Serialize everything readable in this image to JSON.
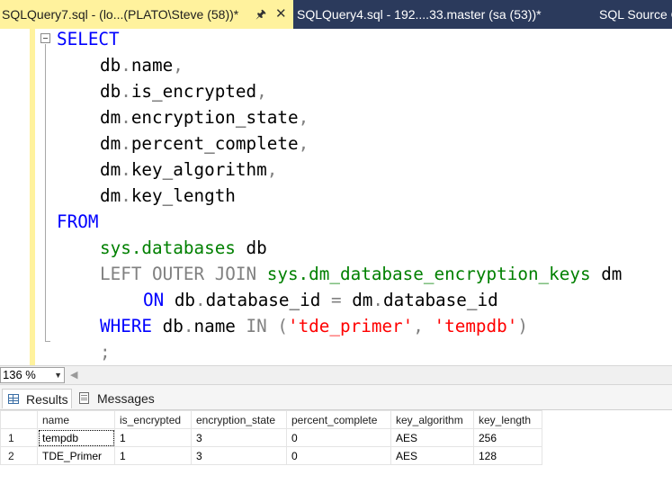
{
  "tabs": [
    {
      "title": "SQLQuery7.sql - (lo...(PLATO\\Steve (58))*",
      "pin_icon": "pin-icon",
      "close_icon": "close-icon"
    },
    {
      "title": "SQLQuery4.sql - 192....33.master (sa (53))*"
    },
    {
      "title": "SQL Source C"
    }
  ],
  "editor": {
    "l1": {
      "kw": "SELECT"
    },
    "l2": {
      "a": "db",
      "dot": ".",
      "b": "name",
      "c": ","
    },
    "l3": {
      "a": "db",
      "dot": ".",
      "b": "is_encrypted",
      "c": ","
    },
    "l4": {
      "a": "dm",
      "dot": ".",
      "b": "encryption_state",
      "c": ","
    },
    "l5": {
      "a": "dm",
      "dot": ".",
      "b": "percent_complete",
      "c": ","
    },
    "l6": {
      "a": "dm",
      "dot": ".",
      "b": "key_algorithm",
      "c": ","
    },
    "l7": {
      "a": "dm",
      "dot": ".",
      "b": "key_length"
    },
    "l8": {
      "kw": "FROM"
    },
    "l9": {
      "sys": "sys.databases",
      "alias": " db"
    },
    "l10": {
      "join": "LEFT OUTER JOIN",
      "sys": " sys.dm_database_encryption_keys",
      "alias": " dm"
    },
    "l11": {
      "kw": "ON",
      "a": " db",
      "dot1": ".",
      "b": "database_id",
      "eq": " = ",
      "c": "dm",
      "dot2": ".",
      "d": "database_id"
    },
    "l12": {
      "kw": "WHERE",
      "a": " db",
      "dot": ".",
      "b": "name",
      "in": " IN ",
      "p1": "(",
      "s1": "'tde_primer'",
      "comma": ", ",
      "s2": "'tempdb'",
      "p2": ")"
    },
    "l13": {
      "semi": ";"
    }
  },
  "zoom": {
    "value": "136 %"
  },
  "results_tabs": {
    "results": "Results",
    "messages": "Messages"
  },
  "results": {
    "columns": [
      "name",
      "is_encrypted",
      "encryption_state",
      "percent_complete",
      "key_algorithm",
      "key_length"
    ],
    "rows": [
      {
        "num": "1",
        "cells": [
          "tempdb",
          "1",
          "3",
          "0",
          "AES",
          "256"
        ]
      },
      {
        "num": "2",
        "cells": [
          "TDE_Primer",
          "1",
          "3",
          "0",
          "AES",
          "128"
        ]
      }
    ]
  }
}
